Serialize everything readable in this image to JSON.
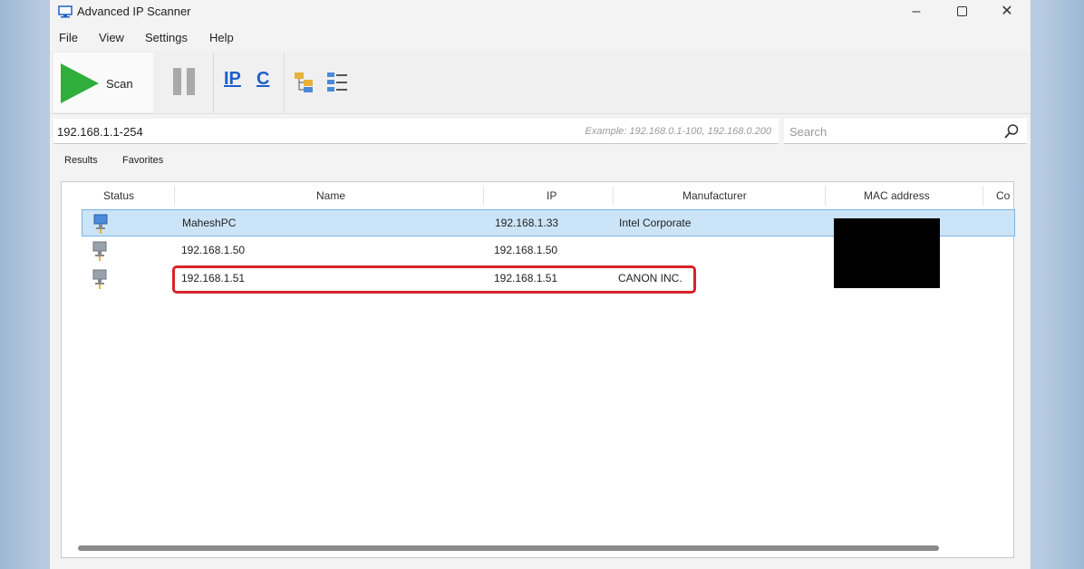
{
  "window": {
    "title": "Advanced IP Scanner",
    "min": "–",
    "close": "✕"
  },
  "menu": [
    "File",
    "View",
    "Settings",
    "Help"
  ],
  "toolbar": {
    "scan_label": "Scan",
    "ip_label": "IP",
    "c_label": "C"
  },
  "range": {
    "value": "192.168.1.1-254",
    "placeholder": "Example: 192.168.0.1-100, 192.168.0.200"
  },
  "search": {
    "placeholder": "Search"
  },
  "tabs": [
    "Results",
    "Favorites"
  ],
  "columns": [
    "Status",
    "Name",
    "IP",
    "Manufacturer",
    "MAC address",
    "Co"
  ],
  "rows": [
    {
      "name": "MaheshPC",
      "ip": "192.168.1.33",
      "manufacturer": "Intel Corporate",
      "selected": true
    },
    {
      "name": "192.168.1.50",
      "ip": "192.168.1.50",
      "manufacturer": "",
      "selected": false
    },
    {
      "name": "192.168.1.51",
      "ip": "192.168.1.51",
      "manufacturer": "CANON INC.",
      "selected": false
    }
  ],
  "colors": {
    "scan_green": "#2fae3c",
    "selection": "#cce4f7",
    "highlight_red": "#d6232a",
    "ip_blue": "#1f5fc9"
  }
}
